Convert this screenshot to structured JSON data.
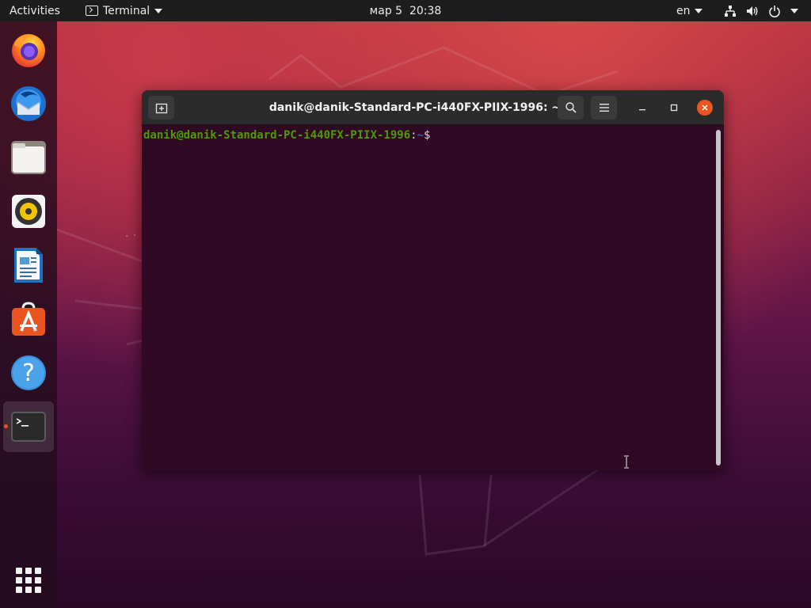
{
  "topbar": {
    "activities": "Activities",
    "app_name": "Terminal",
    "clock": "мар 5  20:38",
    "language": "en"
  },
  "dock": {
    "items": [
      {
        "name": "Firefox",
        "icon": "firefox-icon"
      },
      {
        "name": "Thunderbird",
        "icon": "thunderbird-icon"
      },
      {
        "name": "Files",
        "icon": "files-icon"
      },
      {
        "name": "Rhythmbox",
        "icon": "rhythmbox-icon"
      },
      {
        "name": "LibreOffice Writer",
        "icon": "writer-icon"
      },
      {
        "name": "Ubuntu Software",
        "icon": "software-icon"
      },
      {
        "name": "Help",
        "icon": "help-icon"
      },
      {
        "name": "Terminal",
        "icon": "terminal-icon",
        "running": true
      }
    ],
    "show_apps_icon": "apps-grid-icon"
  },
  "terminal": {
    "title": "danik@danik-Standard-PC-i440FX-PIIX-1996: ~",
    "prompt_user_host": "danik@danik-Standard-PC-i440FX-PIIX-1996",
    "prompt_colon": ":",
    "prompt_path": "~",
    "prompt_symbol": "$"
  },
  "colors": {
    "accent": "#e95420",
    "terminal_bg": "#300a24",
    "prompt_user": "#4e9a06",
    "prompt_path": "#3465a4",
    "topbar_bg": "#1d1d1d"
  }
}
